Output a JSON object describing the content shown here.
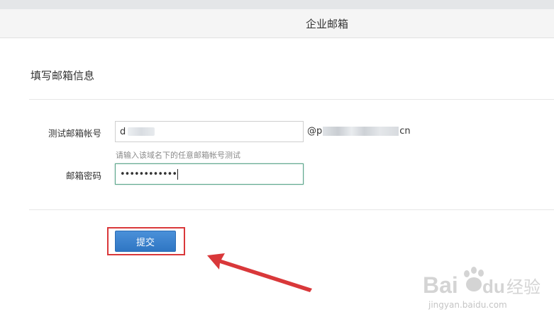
{
  "header": {
    "title": "企业邮箱"
  },
  "section": {
    "title": "填写邮箱信息"
  },
  "form": {
    "account_label": "测试邮箱帐号",
    "account_value": "d",
    "domain_prefix": "@p",
    "domain_suffix": "cn",
    "hint": "请输入该域名下的任意邮箱帐号测试",
    "password_label": "邮箱密码",
    "password_value": "••••••••••••"
  },
  "actions": {
    "submit_label": "提交"
  },
  "annotation": {
    "highlight_color": "#d9383a",
    "arrow_color": "#d9383a"
  },
  "watermark": {
    "brand": "Bai du 经验",
    "url": "jingyan.baidu.com"
  }
}
